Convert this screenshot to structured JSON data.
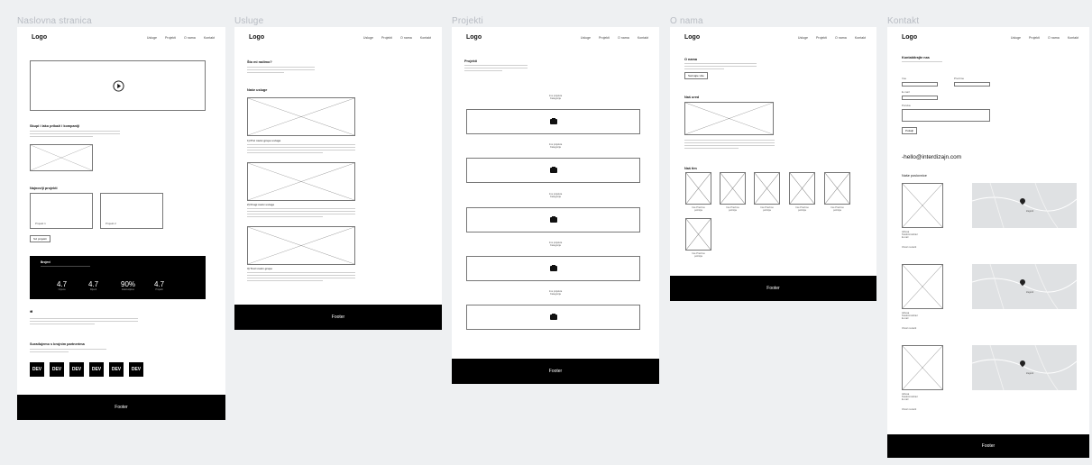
{
  "frames": {
    "home": {
      "title": "Naslovna stranica"
    },
    "services": {
      "title": "Usluge"
    },
    "projects": {
      "title": "Projekti"
    },
    "about": {
      "title": "O nama"
    },
    "contact": {
      "title": "Kontakt"
    }
  },
  "nav": {
    "logo": "Logo",
    "items": [
      "Usluge",
      "Projekti",
      "O nama",
      "Kontakt"
    ],
    "items_services_page": [
      "Usluge",
      "Projekti",
      "O nama",
      "Kontakt"
    ]
  },
  "home": {
    "intro_heading": "Skupi i lako prikaži i kompaniji",
    "projects_heading": "Najnoviji projekti",
    "project1": "Projekt 1",
    "project2": "Projekt 2",
    "all_projects_button": "Svi projekti",
    "stats_heading": "Brojevi",
    "stats": [
      {
        "value": "4.7",
        "label": "Ocjena"
      },
      {
        "value": "4.7",
        "label": "Klijenti"
      },
      {
        "value": "90%",
        "label": "Zadovoljstvo"
      },
      {
        "value": "4.7",
        "label": "Projekti"
      }
    ],
    "quote_mark": "❝",
    "partners_heading": "Surađujemo s brojnim partnerima",
    "partners": [
      "DEV",
      "DEV",
      "DEV",
      "DEV",
      "DEV",
      "DEV"
    ]
  },
  "services": {
    "intro_heading": "Što mi radimo?",
    "section_heading": "Naše usluge",
    "s1": "1) Prvi naziv grupe usluga",
    "s2": "2) Drugi naziv usluge",
    "s3": "3) Treći naziv grupe"
  },
  "projects": {
    "intro_heading": "Projekti",
    "items": [
      {
        "label": "Ime projekta\nKategorija"
      },
      {
        "label": "Ime projekta\nKategorija"
      },
      {
        "label": "Ime projekta\nKategorija"
      },
      {
        "label": "Ime projekta\nKategorija"
      },
      {
        "label": "Ime projekta\nKategorija"
      }
    ]
  },
  "about": {
    "intro_heading": "O nama",
    "button": "Saznajte više",
    "office_heading": "Naš ured",
    "team_heading": "Naš tim",
    "team": [
      {
        "name": "Ime Prezime\npozicija"
      },
      {
        "name": "Ime Prezime\npozicija"
      },
      {
        "name": "Ime Prezime\npozicija"
      },
      {
        "name": "Ime Prezime\npozicija"
      },
      {
        "name": "Ime Prezime\npozicija"
      },
      {
        "name": "Ime Prezime\npozicija"
      }
    ]
  },
  "contact": {
    "form_heading": "Kontaktirajte nas",
    "name_label": "Ime",
    "surname_label": "Prezime",
    "email_label": "E-mail",
    "message_label": "Poruka",
    "send_button": "Pošalji",
    "email": "-hello@interdizajn.com",
    "offices_heading": "Naše poslovnice",
    "city_label": "Zagreb",
    "office_caption": "Adresa\nTelefon/mobitel\nE-mail",
    "directions": "Otvori na karti"
  },
  "footer": {
    "label": "Footer"
  }
}
